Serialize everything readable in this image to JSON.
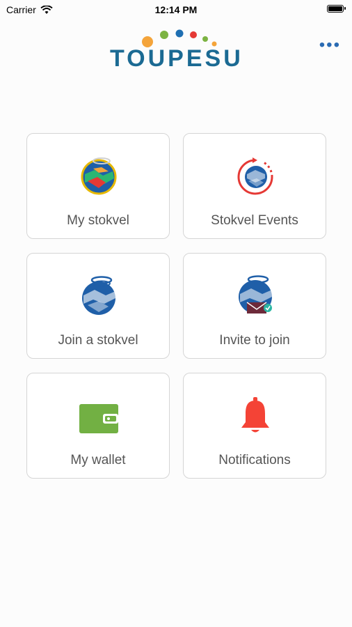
{
  "status_bar": {
    "carrier": "Carrier",
    "time": "12:14 PM"
  },
  "header": {
    "logo_text": "TOUPESU",
    "more_label": "•••"
  },
  "colors": {
    "brand_blue": "#1b6a93",
    "accent_orange": "#f4a43a",
    "accent_green": "#7cb342",
    "accent_red": "#e53935",
    "wallet_green": "#72b043",
    "bell_red": "#f44336"
  },
  "tiles": [
    {
      "label": "My stokvel",
      "icon": "globe-icon"
    },
    {
      "label": "Stokvel Events",
      "icon": "events-globe-icon"
    },
    {
      "label": "Join a stokvel",
      "icon": "join-globe-icon"
    },
    {
      "label": "Invite to join",
      "icon": "invite-globe-icon"
    },
    {
      "label": "My wallet",
      "icon": "wallet-icon"
    },
    {
      "label": "Notifications",
      "icon": "bell-icon"
    }
  ]
}
